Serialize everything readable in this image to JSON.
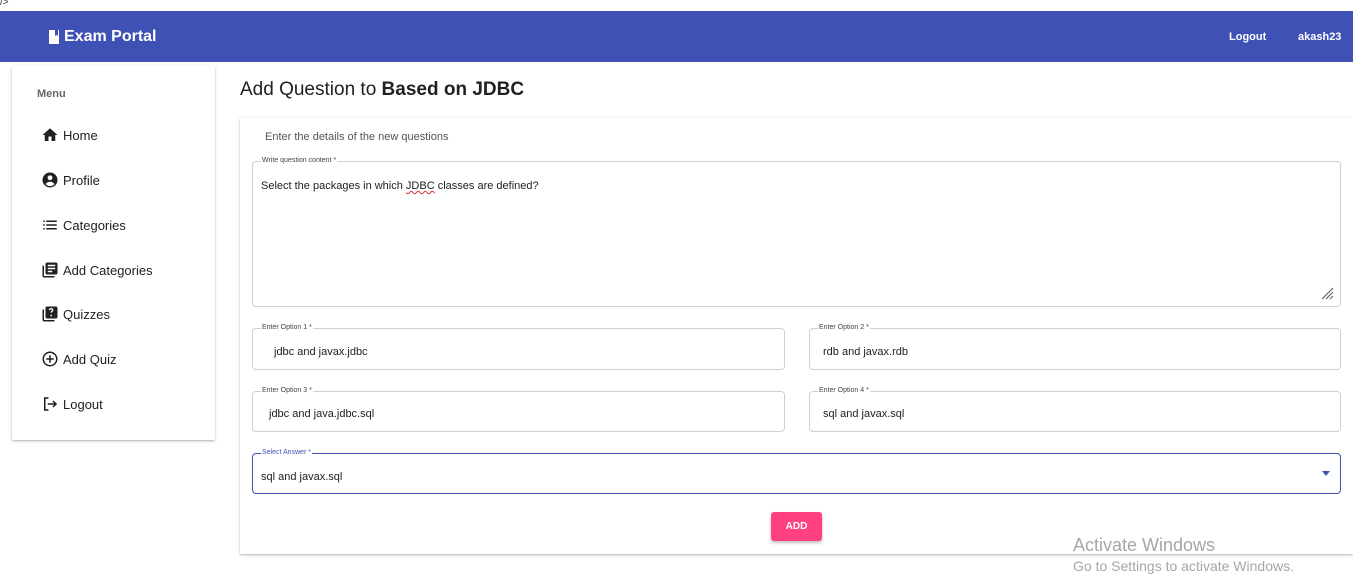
{
  "stray_text": "/>",
  "header": {
    "brand": "Exam Portal",
    "brand_icon": "book-icon",
    "logout_label": "Logout",
    "username": "akash23",
    "color": "#3f51b5"
  },
  "sidebar": {
    "heading": "Menu",
    "items": [
      {
        "label": "Home",
        "icon": "home-icon"
      },
      {
        "label": "Profile",
        "icon": "account-circle-icon"
      },
      {
        "label": "Categories",
        "icon": "list-icon"
      },
      {
        "label": "Add Categories",
        "icon": "library-books-icon"
      },
      {
        "label": "Quizzes",
        "icon": "quiz-icon"
      },
      {
        "label": "Add Quiz",
        "icon": "add-circle-icon"
      },
      {
        "label": "Logout",
        "icon": "logout-icon"
      }
    ]
  },
  "page": {
    "title_prefix": "Add Question to ",
    "title_bold": "Based on JDBC"
  },
  "form": {
    "subtitle": "Enter the details of the new questions",
    "content": {
      "label": "Write question content *",
      "value_before": "Select the packages in which ",
      "value_flagged": "JDBC",
      "value_after": " classes are defined?"
    },
    "option1": {
      "label": "Enter Option 1 *",
      "value": "jdbc and javax.jdbc"
    },
    "option2": {
      "label": "Enter Option 2 *",
      "value": "rdb and javax.rdb"
    },
    "option3": {
      "label": "Enter Option 3 *",
      "value": "jdbc and java.jdbc.sql"
    },
    "option4": {
      "label": "Enter Option 4 *",
      "value": "sql and javax.sql"
    },
    "answer": {
      "label": "Select Answer *",
      "value": "sql and javax.sql"
    },
    "add_label": "ADD",
    "add_color": "#ff4081"
  },
  "watermark": {
    "title": "Activate Windows",
    "subtitle": "Go to Settings to activate Windows."
  }
}
